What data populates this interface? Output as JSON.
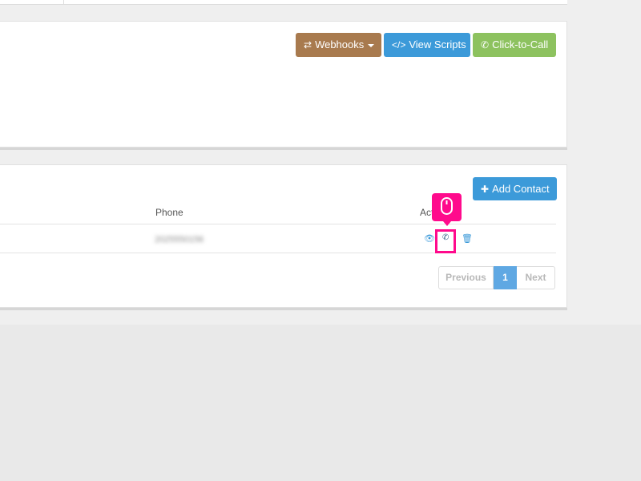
{
  "toolbar": {
    "webhooks_label": "Webhooks",
    "view_scripts_label": "View Scripts",
    "click_to_call_label": "Click-to-Call"
  },
  "contacts": {
    "add_contact_label": "Add Contact",
    "columns": [
      "Phone",
      "Act"
    ],
    "rows": [
      {
        "phone": "2025550156"
      }
    ],
    "pagination": {
      "previous": "Previous",
      "current": "1",
      "next": "Next"
    }
  },
  "colors": {
    "webhooks": "#a87a4e",
    "primary": "#3c9ad9",
    "success": "#8dc25f",
    "highlight": "#ff0a8c"
  },
  "icons": [
    "exchange-icon",
    "code-icon",
    "phone-icon",
    "plus-icon",
    "eye-icon",
    "trash-icon",
    "mouse-icon"
  ]
}
